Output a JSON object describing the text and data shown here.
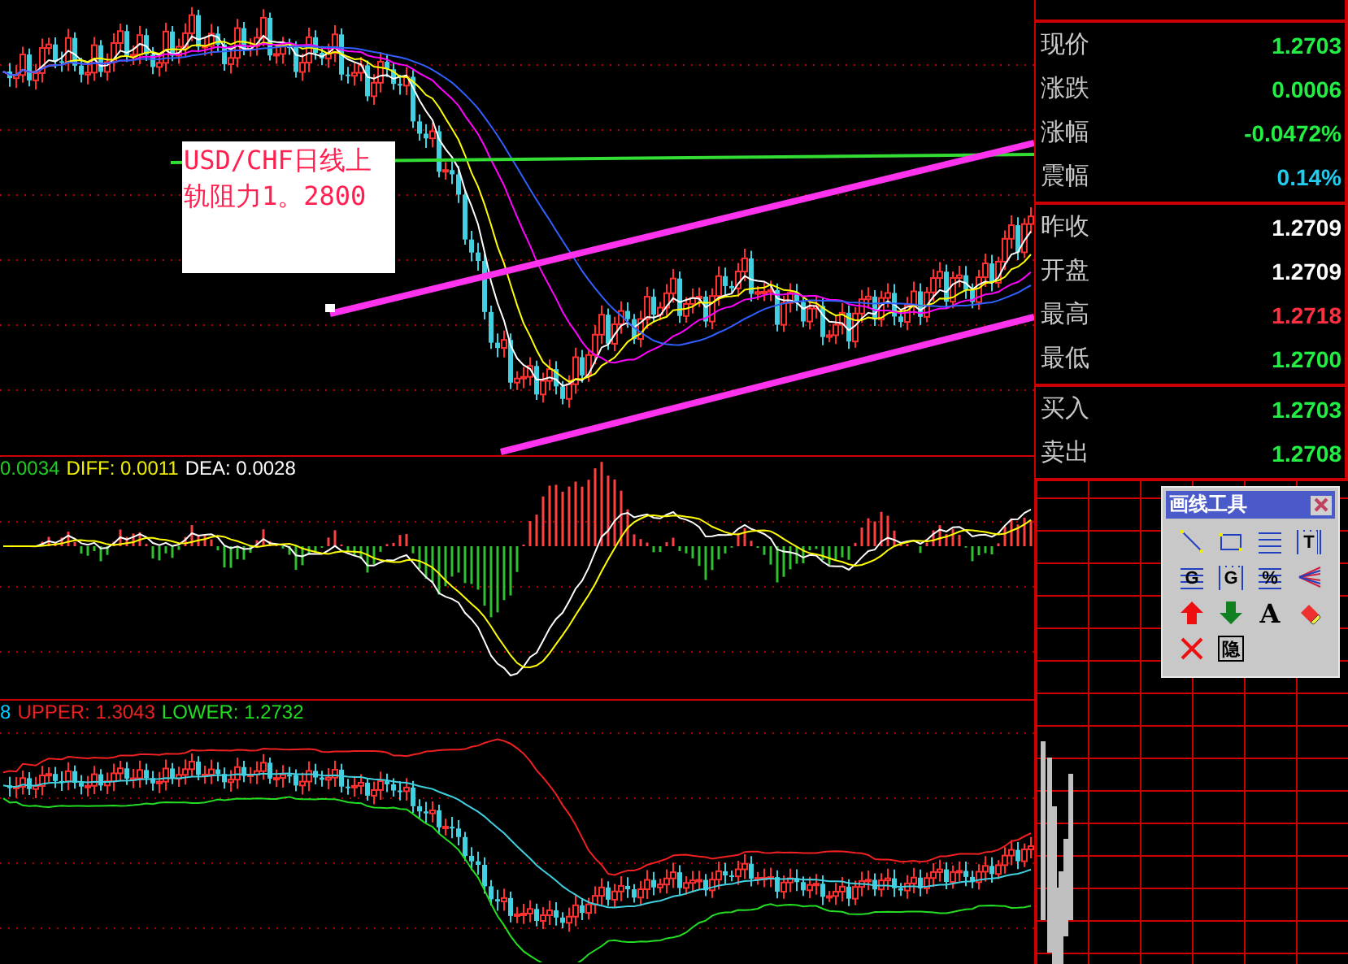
{
  "annotation": {
    "lines": [
      "USD/CHF日线上",
      "轨阻力1。2800"
    ]
  },
  "macd_legend": [
    {
      "text": "0.0034",
      "color": "#22cc22"
    },
    {
      "text": "DIFF: 0.0011",
      "color": "#eeee00"
    },
    {
      "text": "DEA: 0.0028",
      "color": "#ffffff"
    }
  ],
  "boll_legend": [
    {
      "text": "8",
      "color": "#00ccff"
    },
    {
      "text": "UPPER: 1.3043",
      "color": "#ee2020"
    },
    {
      "text": "LOWER: 1.2732",
      "color": "#22dd22"
    }
  ],
  "quote": {
    "groups": [
      {
        "rows": [
          {
            "label": "现价",
            "value": "1.2703",
            "color": "#22ee44"
          },
          {
            "label": "涨跌",
            "value": "0.0006",
            "color": "#22ee44"
          },
          {
            "label": "涨幅",
            "value": "-0.0472%",
            "color": "#22ee44"
          },
          {
            "label": "震幅",
            "value": "0.14%",
            "color": "#22ccee"
          }
        ]
      },
      {
        "rows": [
          {
            "label": "昨收",
            "value": "1.2709",
            "color": "#ffffff"
          },
          {
            "label": "开盘",
            "value": "1.2709",
            "color": "#ffffff"
          },
          {
            "label": "最高",
            "value": "1.2718",
            "color": "#ff3040"
          },
          {
            "label": "最低",
            "value": "1.2700",
            "color": "#22ee44"
          }
        ]
      },
      {
        "rows": [
          {
            "label": "买入",
            "value": "1.2703",
            "color": "#22ee44"
          },
          {
            "label": "卖出",
            "value": "1.2708",
            "color": "#22ee44"
          }
        ]
      }
    ]
  },
  "toolbox": {
    "title": "画线工具",
    "tools": [
      {
        "kind": "line"
      },
      {
        "kind": "rect"
      },
      {
        "kind": "hlines"
      },
      {
        "kind": "vlines",
        "glyph": "T"
      },
      {
        "kind": "hlines",
        "glyph": "G"
      },
      {
        "kind": "vlines",
        "glyph": "G"
      },
      {
        "kind": "hlines",
        "glyph": "%"
      },
      {
        "kind": "fan"
      },
      {
        "kind": "up"
      },
      {
        "kind": "down"
      },
      {
        "kind": "text",
        "glyph": "A"
      },
      {
        "kind": "eraser"
      },
      {
        "kind": "delete"
      },
      {
        "kind": "hide",
        "glyph": "隐"
      }
    ]
  }
}
